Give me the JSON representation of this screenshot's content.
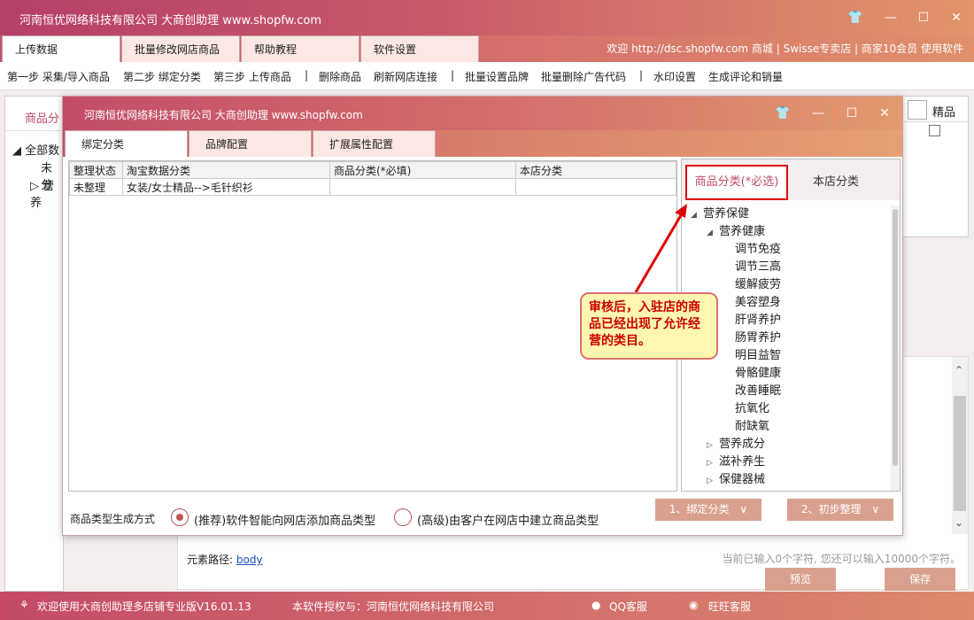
{
  "app": {
    "title": "河南恒优网络科技有限公司 大商创助理 www.shopfw.com",
    "welcome": "欢迎 http://dsc.shopfw.com 商城 | Swisse专卖店 | 商家10会员 使用软件"
  },
  "main_tabs": [
    "上传数据",
    "批量修改网店商品",
    "帮助教程",
    "软件设置"
  ],
  "toolbar": {
    "items": [
      "第一步 采集/导入商品",
      "第二步 绑定分类",
      "第三步 上传商品",
      "|",
      "删除商品",
      "刷新网店连接",
      "|",
      "批量设置品牌",
      "批量删除广告代码",
      "|",
      "水印设置",
      "生成评论和销量"
    ]
  },
  "background": {
    "left_tab": "商品分",
    "tree": [
      "全部数",
      "未分",
      "营养"
    ],
    "right_col": "精品",
    "path_label": "元素路径:",
    "path_value": "body",
    "char_count": "当前已输入0个字符, 您还可以输入10000个字符。",
    "preview_btn": "预览",
    "save_btn": "保存"
  },
  "dialog": {
    "title": "河南恒优网络科技有限公司 大商创助理 www.shopfw.com",
    "tabs": [
      "绑定分类",
      "品牌配置",
      "扩展属性配置"
    ],
    "table_headers": [
      "整理状态",
      "淘宝数据分类",
      "商品分类(*必填)",
      "本店分类"
    ],
    "table_rows": [
      [
        "未整理",
        "女装/女士精品-->毛针织衫",
        "",
        ""
      ]
    ],
    "right_tabs": [
      "商品分类(*必选)",
      "本店分类"
    ],
    "tree": [
      {
        "label": "营养保健",
        "level": 0,
        "expanded": true
      },
      {
        "label": "营养健康",
        "level": 1,
        "expanded": true
      },
      {
        "label": "调节免疫",
        "level": 2
      },
      {
        "label": "调节三高",
        "level": 2
      },
      {
        "label": "缓解疲劳",
        "level": 2
      },
      {
        "label": "美容塑身",
        "level": 2
      },
      {
        "label": "肝肾养护",
        "level": 2
      },
      {
        "label": "肠胃养护",
        "level": 2
      },
      {
        "label": "明目益智",
        "level": 2
      },
      {
        "label": "骨骼健康",
        "level": 2
      },
      {
        "label": "改善睡眠",
        "level": 2
      },
      {
        "label": "抗氧化",
        "level": 2
      },
      {
        "label": "耐缺氧",
        "level": 2
      },
      {
        "label": "营养成分",
        "level": 1,
        "expanded": false
      },
      {
        "label": "滋补养生",
        "level": 1,
        "expanded": false
      },
      {
        "label": "保健器械",
        "level": 1,
        "expanded": false
      }
    ],
    "gen_label": "商品类型生成方式",
    "radio_options": [
      "(推荐)软件智能向网店添加商品类型",
      "(高级)由客户在网店中建立商品类型"
    ],
    "selected_radio": 0,
    "btn_bind": "1、绑定分类",
    "btn_init": "2、初步整理"
  },
  "callout": {
    "text": "审核后，入驻店的商品已经出现了允许经营的类目。"
  },
  "statusbar": {
    "welcome": "欢迎使用大商创助理多店铺专业版V16.01.13",
    "license": "本软件授权与：河南恒优网络科技有限公司",
    "qq": "QQ客服",
    "wangwang": "旺旺客服"
  },
  "colors": {
    "accent": "#c34d69",
    "button": "#d9a08f",
    "highlight_red": "#e00000",
    "callout_bg": "#fff7b0"
  }
}
